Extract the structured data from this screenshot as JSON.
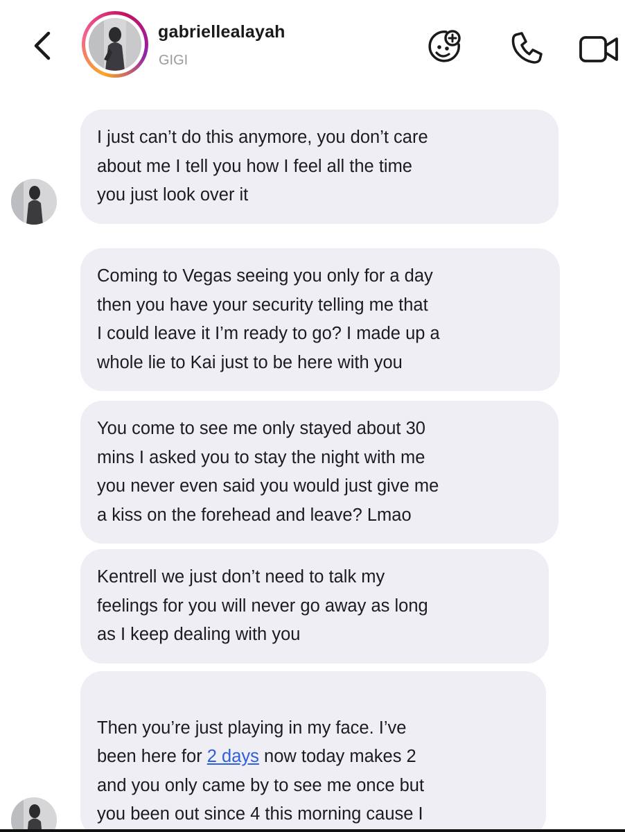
{
  "header": {
    "username": "gabriellealayah",
    "subtitle": "GIGI",
    "icons": {
      "back": "chevron-left-icon",
      "sticker": "sticker-add-icon",
      "call": "phone-icon",
      "video": "video-camera-icon"
    }
  },
  "colors": {
    "bubble_bg": "#efeef5",
    "link": "#2f5fd9",
    "subtitle": "#9a9a9a",
    "story_ring": [
      "#f9a825",
      "#f06292",
      "#c51162",
      "#8e24aa"
    ]
  },
  "messages": [
    {
      "text": "I just can’t do this anymore, you don’t care\nabout me I tell you how I feel all the time\nyou just look over it"
    },
    {
      "text": "Coming to Vegas seeing you only for a day\nthen you have your security telling me that\nI could leave it I’m ready to go? I made up a\nwhole lie to Kai just to be here with you"
    },
    {
      "text": "You come to see me only stayed about 30\nmins I asked you to stay the night with me\nyou never even said you would just give me\na kiss on the forehead and leave? Lmao"
    },
    {
      "text": "Kentrell we just don’t need to talk my\nfeelings for you will never go away as long\nas I keep dealing with you"
    },
    {
      "text_before_link": "Then you’re just playing in my face. I’ve\nbeen here for ",
      "link_text": "2 days",
      "text_after_link": " now today makes 2\nand you only came by to see me once but\nyou been out since 4 this morning cause I\nseen you going live"
    }
  ]
}
